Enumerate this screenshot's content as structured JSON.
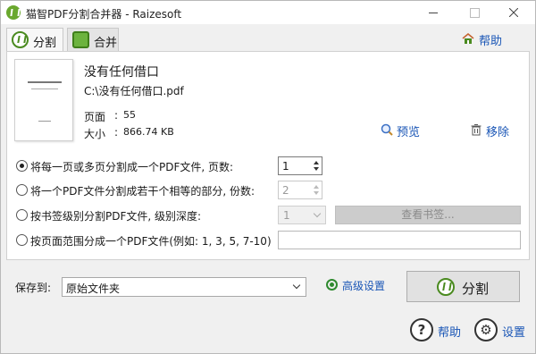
{
  "titlebar": {
    "title": "猫智PDF分割合并器 - Raizesoft",
    "minimize": "minimize",
    "maximize": "maximize",
    "close": "close"
  },
  "tabs": [
    {
      "label": "分割",
      "icon": "scissors-icon",
      "active": true
    },
    {
      "label": "合并",
      "icon": "merge-icon",
      "active": false
    }
  ],
  "top_help": {
    "label": "帮助",
    "icon": "house-icon"
  },
  "document": {
    "title": "没有任何借口",
    "path": "C:\\没有任何借口.pdf",
    "pages_label": "页面",
    "pages": "55",
    "size_label": "大小",
    "size": "866.74 KB",
    "preview_label": "预览",
    "remove_label": "移除"
  },
  "options": [
    {
      "label": "将每一页或多页分割成一个PDF文件, 页数:",
      "selected": true,
      "value": "1"
    },
    {
      "label": "将一个PDF文件分割成若干个相等的部分, 份数:",
      "selected": false,
      "value": "2"
    },
    {
      "label": "按书签级别分割PDF文件, 级别深度:",
      "selected": false,
      "value": "1",
      "button_label": "查看书签..."
    },
    {
      "label": "按页面范围分成一个PDF文件(例如: 1, 3, 5, 7-10)",
      "selected": false,
      "value": ""
    }
  ],
  "save": {
    "label": "保存到:",
    "value": "原始文件夹",
    "advanced_label": "高级设置",
    "split_button": "分割"
  },
  "footer": {
    "help_label": "帮助",
    "settings_label": "设置"
  },
  "colors": {
    "accent_green": "#4a8a1f",
    "link_blue": "#1a56b6"
  }
}
